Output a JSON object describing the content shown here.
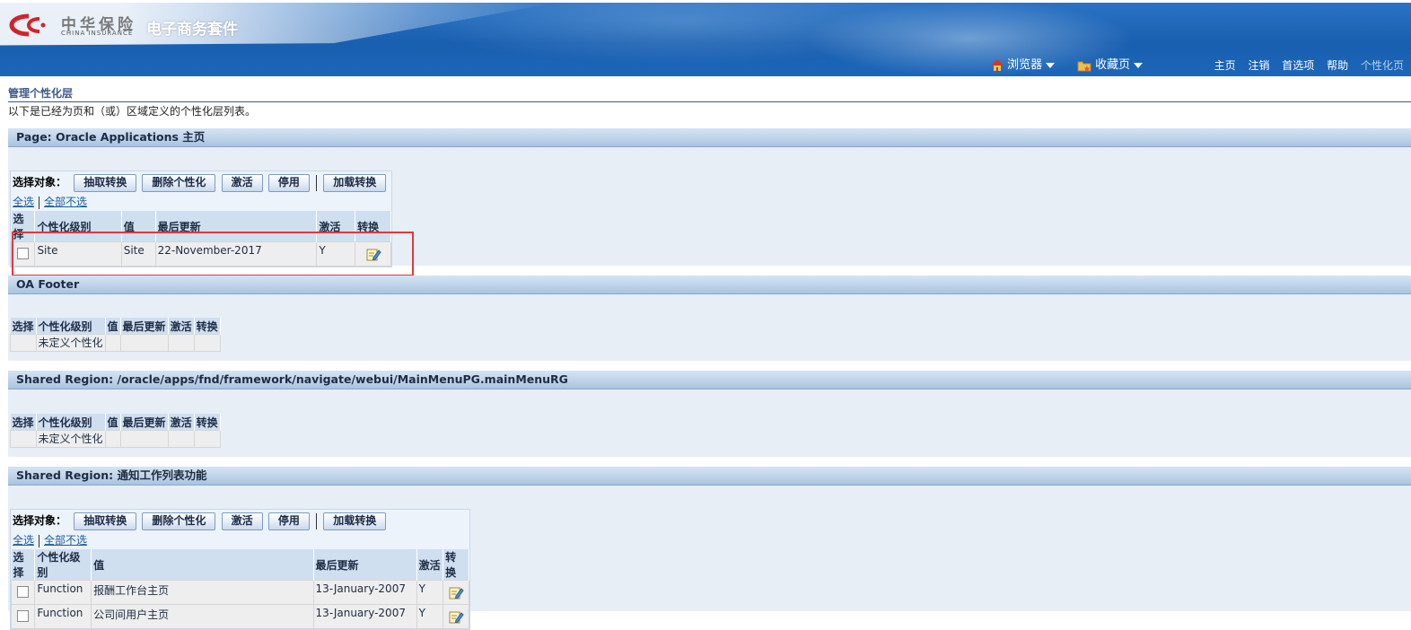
{
  "header": {
    "logo_cn": "中华保险",
    "logo_en": "CHINA INSURANCE",
    "app_title": "电子商务套件",
    "browser_menu": "浏览器",
    "favorites_menu": "收藏页",
    "links": [
      "主页",
      "注销",
      "首选项",
      "帮助",
      "个性化页"
    ]
  },
  "page": {
    "title": "管理个性化层",
    "instruction": "以下是已经为页和（或）区域定义的个性化层列表。"
  },
  "action_bar": {
    "label": "选择对象：",
    "buttons": [
      "抽取转换",
      "删除个性化",
      "激活",
      "停用",
      "加载转换"
    ],
    "select_all": "全选",
    "deselect_all": "全部不选"
  },
  "columns": [
    "选择",
    "个性化级别",
    "值",
    "最后更新",
    "激活",
    "转换"
  ],
  "sections": [
    {
      "title": "Page: Oracle Applications 主页",
      "rows": [
        {
          "level": "Site",
          "value": "Site",
          "updated": "22-November-2017",
          "active": "Y"
        }
      ]
    },
    {
      "title": "OA Footer",
      "empty_text": "未定义个性化"
    },
    {
      "title": "Shared Region: /oracle/apps/fnd/framework/navigate/webui/MainMenuPG.mainMenuRG",
      "empty_text": "未定义个性化"
    },
    {
      "title": "Shared Region: 通知工作列表功能",
      "rows": [
        {
          "level": "Function",
          "value": "报酬工作台主页",
          "updated": "13-January-2007",
          "active": "Y"
        },
        {
          "level": "Function",
          "value": "公司间用户主页",
          "updated": "13-January-2007",
          "active": "Y"
        }
      ]
    }
  ],
  "colors": {
    "accent": "#1a5fb0",
    "highlight": "#e0393c",
    "section_bg": "#e8eef6"
  }
}
